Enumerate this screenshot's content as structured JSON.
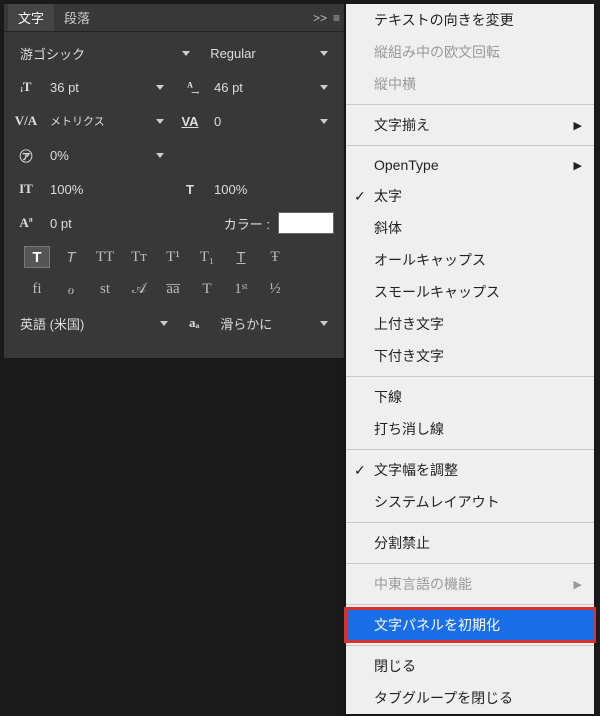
{
  "tabs": {
    "char": "文字",
    "para": "段落",
    "expand": ">>"
  },
  "font": {
    "family": "游ゴシック",
    "style": "Regular"
  },
  "size": {
    "fontSize": "36 pt",
    "leading": "46 pt"
  },
  "kern": {
    "va": "メトリクス",
    "tracking": "0"
  },
  "tsume": "0%",
  "scale": {
    "v": "100%",
    "h": "100%"
  },
  "baseline": {
    "shift": "0 pt",
    "colorLabel": "カラー :"
  },
  "lang": {
    "value": "英語 (米国)",
    "aa": "滑らかに"
  },
  "menu": {
    "orient": "テキストの向きを変更",
    "tatechuyoko1": "縦組み中の欧文回転",
    "tatechuyoko2": "縦中横",
    "justify": "文字揃え",
    "opentype": "OpenType",
    "bold": "太字",
    "italic": "斜体",
    "allcaps": "オールキャップス",
    "smallcaps": "スモールキャップス",
    "superscript": "上付き文字",
    "subscript": "下付き文字",
    "underline": "下線",
    "strike": "打ち消し線",
    "adjustwidth": "文字幅を調整",
    "syslayout": "システムレイアウト",
    "nobreak": "分割禁止",
    "mideast": "中東言語の機能",
    "reset": "文字パネルを初期化",
    "close": "閉じる",
    "closegroup": "タブグループを閉じる"
  }
}
